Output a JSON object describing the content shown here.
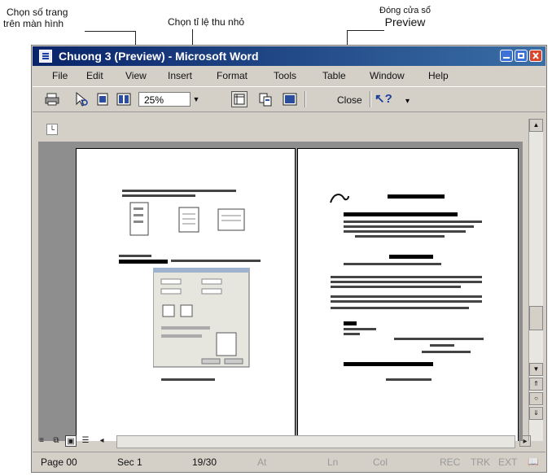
{
  "callouts": {
    "pages_on_screen": [
      "Chọn số trang",
      "trên màn hình"
    ],
    "zoom_ratio": "Chọn tỉ lệ thu nhỏ",
    "close_preview": [
      "Đóng cửa sổ",
      "Preview"
    ]
  },
  "window": {
    "title": "Chuong 3 (Preview) - Microsoft Word",
    "menu": [
      "File",
      "Edit",
      "View",
      "Insert",
      "Format",
      "Tools",
      "Table",
      "Window",
      "Help"
    ]
  },
  "toolbar": {
    "zoom_value": "25%",
    "close_label": "Close",
    "icons": [
      "print-icon",
      "magnifier-icon",
      "one-page-icon",
      "multiple-pages-icon",
      "view-ruler-icon",
      "shrink-to-fit-icon",
      "full-screen-icon",
      "context-help-icon"
    ]
  },
  "statusbar": {
    "page": "Page 00",
    "section": "Sec 1",
    "page_of": "19/30",
    "at": "At",
    "ln": "Ln",
    "col": "Col",
    "rec": "REC",
    "trk": "TRK",
    "ext": "EXT"
  }
}
